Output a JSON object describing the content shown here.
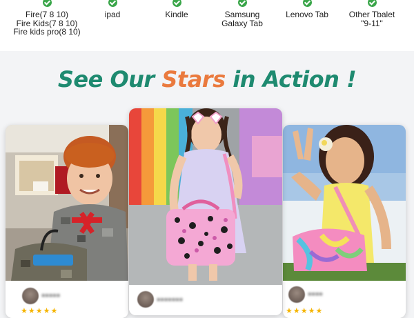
{
  "compatibility": [
    {
      "label": "Fire(7 8 10)\nFire Kids(7 8 10)\nFire kids pro(8 10)",
      "icon": "check-icon"
    },
    {
      "label": "ipad",
      "icon": "check-icon"
    },
    {
      "label": "Kindle",
      "icon": "check-icon"
    },
    {
      "label": "Samsung\nGalaxy Tab",
      "icon": "check-icon"
    },
    {
      "label": "Lenovo Tab",
      "icon": "check-icon"
    },
    {
      "label": "Other Tbalet\n\"9-11\"",
      "icon": "check-icon"
    }
  ],
  "headline": {
    "part1": "See Our ",
    "part2": "Stars",
    "part3": " in Action !"
  },
  "colors": {
    "headline_green": "#1e8a70",
    "headline_orange": "#ea7a3e",
    "check_green": "#3aa64a",
    "star_gold": "#f5b400"
  },
  "cards": [
    {
      "subject": "boy holding camo lunch bag",
      "rating": "★★★★★"
    },
    {
      "subject": "girl with pink leopard lunch bag",
      "rating": "★★★★★"
    },
    {
      "subject": "girl with tie-dye lunch bag",
      "rating": "★★★★★"
    }
  ]
}
